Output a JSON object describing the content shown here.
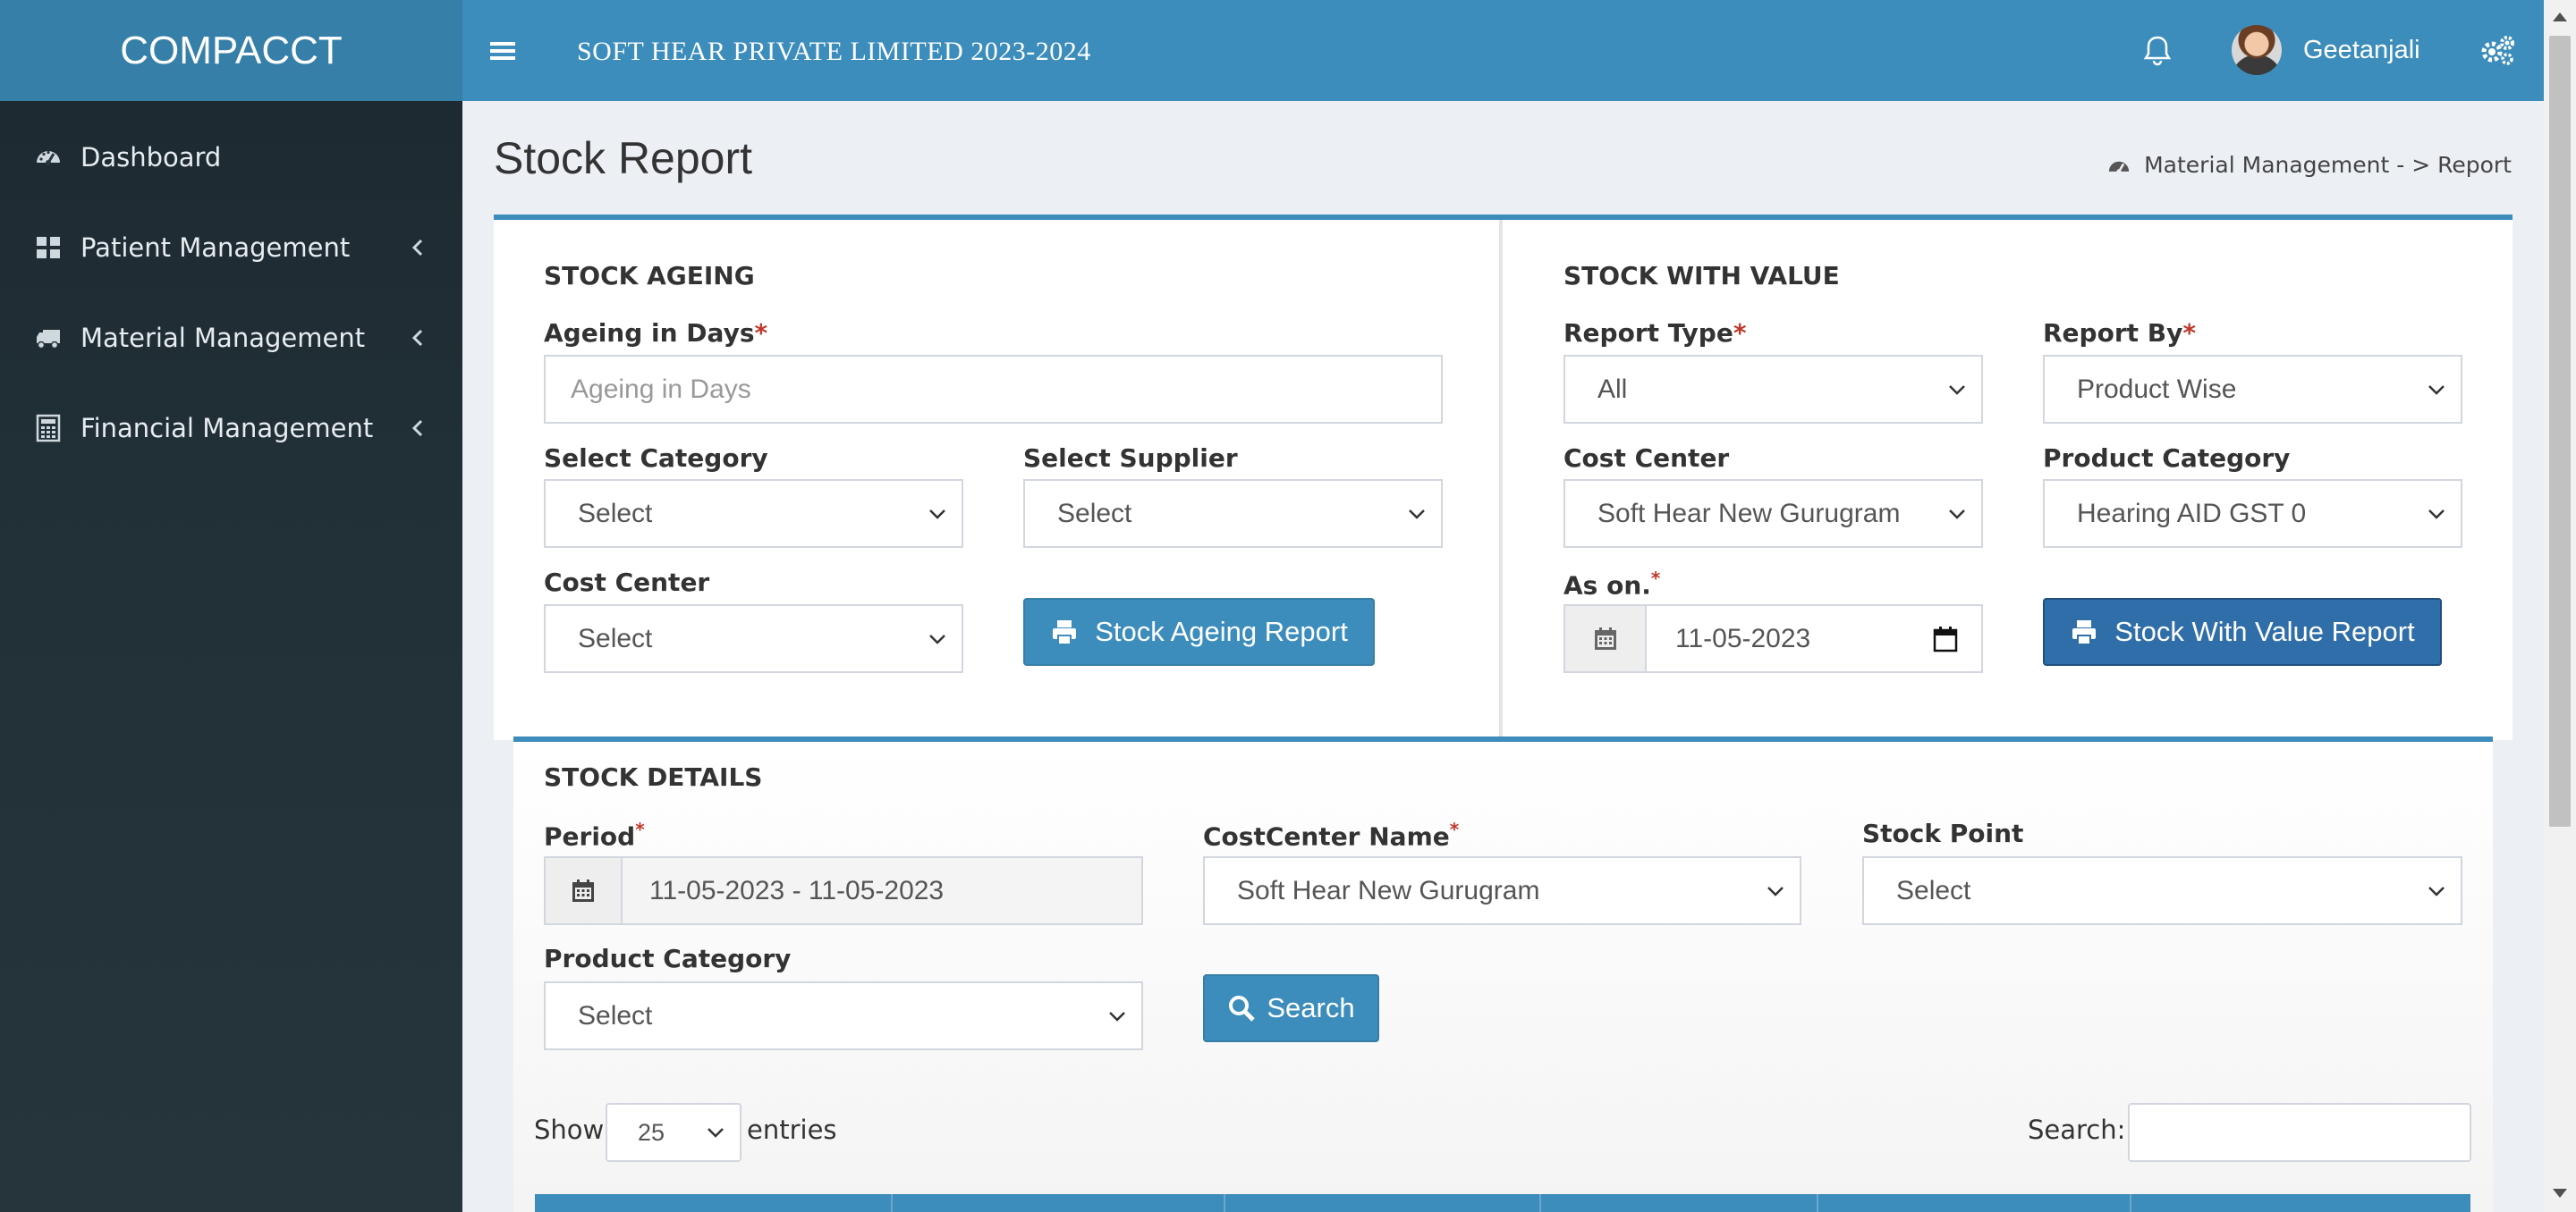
{
  "app": {
    "logo": "COMPACCT",
    "company": "SOFT HEAR PRIVATE LIMITED  2023-2024",
    "user": "Geetanjali"
  },
  "sidebar": {
    "items": [
      {
        "label": "Dashboard",
        "icon": "dashboard-icon"
      },
      {
        "label": "Patient Management",
        "icon": "grid-icon"
      },
      {
        "label": "Material Management",
        "icon": "truck-icon"
      },
      {
        "label": "Financial Management",
        "icon": "calculator-icon"
      }
    ]
  },
  "page": {
    "title": "Stock Report",
    "breadcrumb": "Material Management - > Report"
  },
  "ageing": {
    "title": "STOCK AGEING",
    "days_label": "Ageing in Days",
    "days_placeholder": "Ageing in Days",
    "category_label": "Select Category",
    "category_value": "Select",
    "supplier_label": "Select Supplier",
    "supplier_value": "Select",
    "costcenter_label": "Cost Center",
    "costcenter_value": "Select",
    "button": "Stock Ageing Report"
  },
  "value": {
    "title": "STOCK WITH VALUE",
    "report_type_label": "Report Type",
    "report_type_value": "All",
    "report_by_label": "Report By",
    "report_by_value": "Product Wise",
    "costcenter_label": "Cost Center",
    "costcenter_value": "Soft Hear New Gurugram",
    "category_label": "Product Category",
    "category_value": "Hearing AID GST 0",
    "ason_label": "As on.",
    "ason_value": "11-05-2023",
    "button": "Stock With Value Report"
  },
  "details": {
    "title": "STOCK DETAILS",
    "period_label": "Period",
    "period_value": "11-05-2023 - 11-05-2023",
    "costcenter_label": "CostCenter Name",
    "costcenter_value": "Soft Hear New Gurugram",
    "stockpoint_label": "Stock Point",
    "stockpoint_value": "Select",
    "category_label": "Product Category",
    "category_value": "Select",
    "search_button": "Search"
  },
  "table": {
    "show_label": "Show",
    "entries_value": "25",
    "entries_label": "entries",
    "search_label": "Search:"
  },
  "colors": {
    "header": "#3c8dbc",
    "sidebar": "#222d32",
    "primary_button": "#2f6ea8",
    "required": "#c0392b"
  }
}
